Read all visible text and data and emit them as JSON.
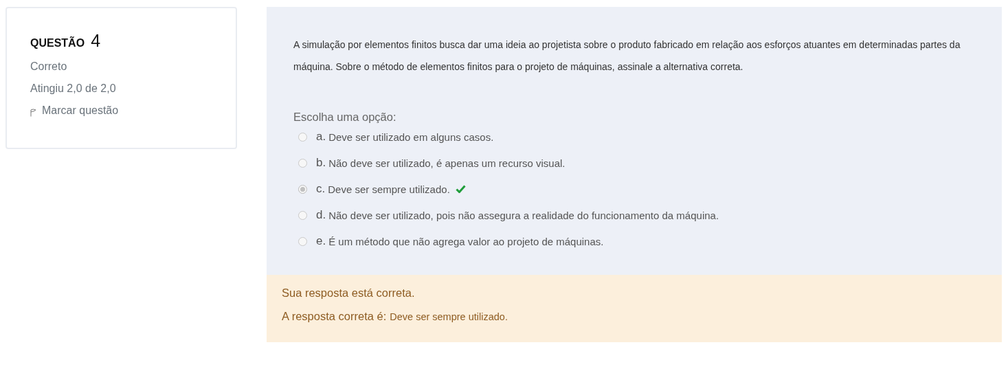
{
  "info": {
    "heading": "QUESTÃO",
    "number": "4",
    "status": "Correto",
    "grade": "Atingiu 2,0 de 2,0",
    "flag_label": "Marcar questão"
  },
  "question": {
    "text": "A simulação por elementos finitos busca dar uma ideia ao projetista sobre o produto fabricado em relação aos esforços atuantes em determinadas partes da máquina. Sobre o método de elementos finitos para o projeto de máquinas, assinale a alternativa correta.",
    "prompt": "Escolha uma opção:",
    "options": [
      {
        "letter": "a.",
        "text": "Deve ser utilizado em alguns casos.",
        "selected": false,
        "correct": false
      },
      {
        "letter": "b.",
        "text": "Não deve ser utilizado, é apenas um recurso visual.",
        "selected": false,
        "correct": false
      },
      {
        "letter": "c.",
        "text": "Deve ser sempre utilizado.",
        "selected": true,
        "correct": true
      },
      {
        "letter": "d.",
        "text": "Não deve ser utilizado, pois não assegura a realidade do funcionamento da máquina.",
        "selected": false,
        "correct": false
      },
      {
        "letter": "e.",
        "text": "É um método que não agrega valor ao projeto de máquinas.",
        "selected": false,
        "correct": false
      }
    ]
  },
  "feedback": {
    "message": "Sua resposta está correta.",
    "answer_label": "A resposta correta é:",
    "answer": "Deve ser sempre utilizado."
  }
}
